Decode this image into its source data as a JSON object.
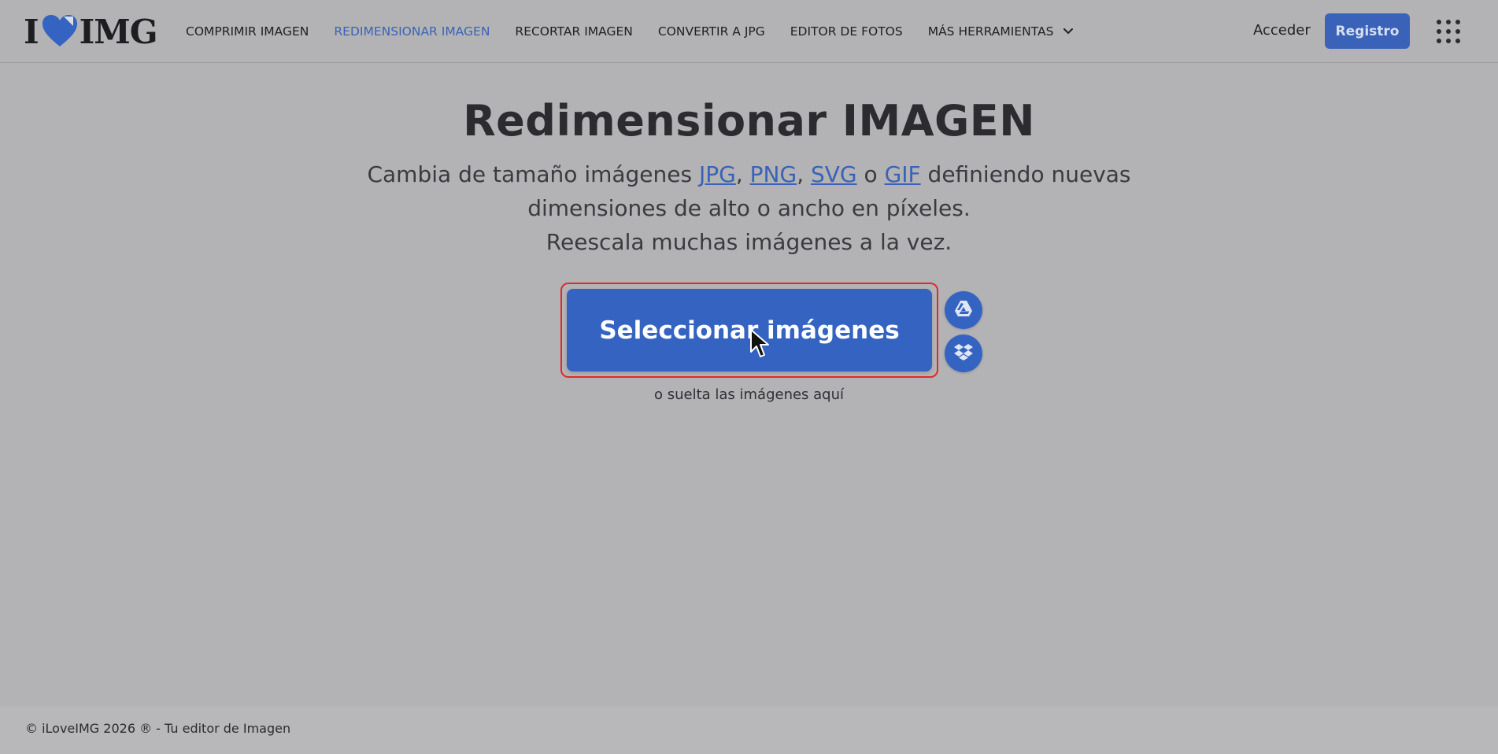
{
  "header": {
    "logo_left": "I",
    "logo_right": "IMG",
    "nav": [
      {
        "label": "COMPRIMIR IMAGEN",
        "active": false
      },
      {
        "label": "REDIMENSIONAR IMAGEN",
        "active": true
      },
      {
        "label": "RECORTAR IMAGEN",
        "active": false
      },
      {
        "label": "CONVERTIR A JPG",
        "active": false
      },
      {
        "label": "EDITOR DE FOTOS",
        "active": false
      },
      {
        "label": "MÁS HERRAMIENTAS",
        "active": false
      }
    ],
    "login_label": "Acceder",
    "register_label": "Registro"
  },
  "main": {
    "title": "Redimensionar IMAGEN",
    "subtitle_prefix": "Cambia de tamaño imágenes ",
    "formats": [
      "JPG",
      "PNG",
      "SVG",
      "GIF"
    ],
    "sep_comma": ",",
    "sep_or": "o",
    "subtitle_suffix": " definiendo nuevas",
    "subtitle_line2": "dimensiones de alto o ancho en píxeles.",
    "subtitle_line3": "Reescala muchas imágenes a la vez.",
    "select_button": "Seleccionar imágenes",
    "drop_hint": "o suelta las imágenes aquí"
  },
  "footer": {
    "text": "© iLoveIMG 2026 ® - Tu editor de Imagen"
  },
  "colors": {
    "brand": "#3463c1",
    "active_nav": "#3a62b8",
    "highlight_border": "#e02a2a",
    "background": "#b3b3b5"
  },
  "icons": [
    "heart-logo-icon",
    "chevron-down-icon",
    "apps-grid-icon",
    "google-drive-icon",
    "dropbox-icon",
    "mouse-cursor-icon"
  ]
}
